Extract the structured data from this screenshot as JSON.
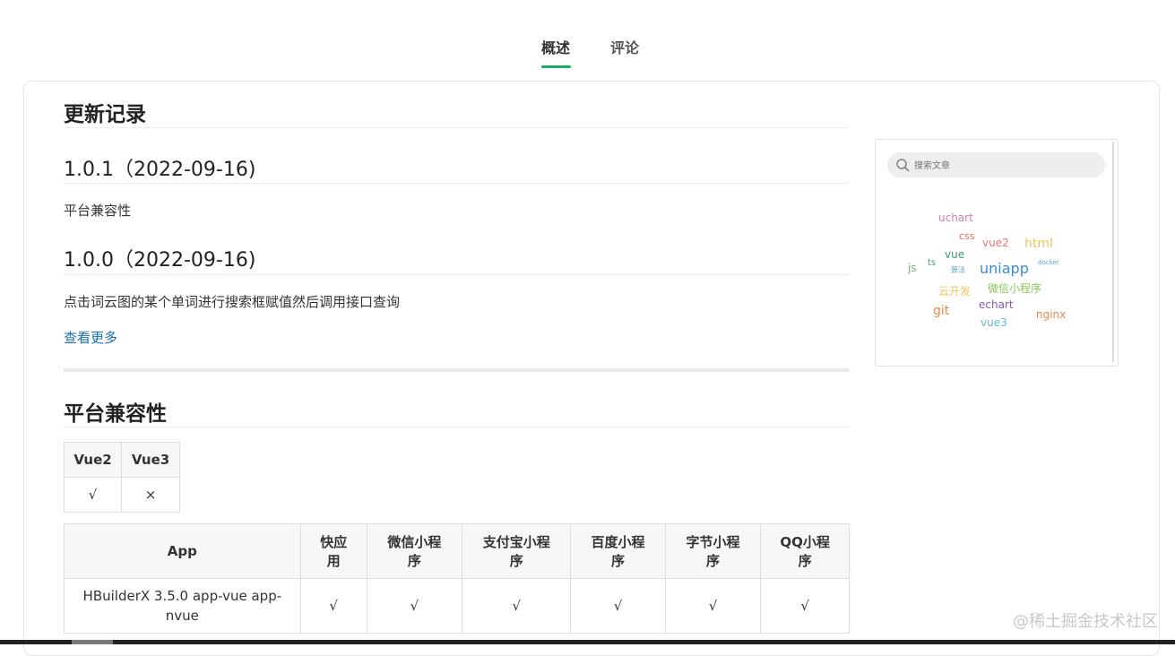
{
  "tabs": [
    "概述",
    "评论"
  ],
  "changelog": {
    "title": "更新记录",
    "versions": [
      {
        "heading": "1.0.1（2022-09-16)",
        "note": "平台兼容性"
      },
      {
        "heading": "1.0.0（2022-09-16)",
        "note": "点击词云图的某个单词进行搜索框赋值然后调用接口查询"
      }
    ],
    "more_label": "查看更多"
  },
  "compat": {
    "title": "平台兼容性",
    "vue_headers": [
      "Vue2",
      "Vue3"
    ],
    "vue_values": [
      "√",
      "×"
    ],
    "platform_headers": [
      "App",
      "快应\n用",
      "微信小程\n序",
      "支付宝小程\n序",
      "百度小程\n序",
      "字节小程\n序",
      "QQ小程\n序"
    ],
    "platform_row": [
      "HBuilderX 3.5.0 app-vue app-\nnvue",
      "√",
      "√",
      "√",
      "√",
      "√",
      "√"
    ]
  },
  "sidebar": {
    "search_placeholder": "搜索文章",
    "icon": "search-icon",
    "word_cloud": [
      {
        "text": "uchart",
        "color": "#d17fb8"
      },
      {
        "text": "css",
        "color": "#e86a6a"
      },
      {
        "text": "vue2",
        "color": "#e8747a"
      },
      {
        "text": "html",
        "color": "#f2c35a"
      },
      {
        "text": "js",
        "color": "#6aba6a"
      },
      {
        "text": "ts",
        "color": "#4a9a7a"
      },
      {
        "text": "vue",
        "color": "#3a9a6a"
      },
      {
        "text": "算法",
        "color": "#5aa5c5"
      },
      {
        "text": "uniapp",
        "color": "#3a8ad5"
      },
      {
        "text": "docker",
        "color": "#5aa5d5"
      },
      {
        "text": "云开发",
        "color": "#f2c35a"
      },
      {
        "text": "微信小程序",
        "color": "#8ac85a"
      },
      {
        "text": "git",
        "color": "#e8874a"
      },
      {
        "text": "echart",
        "color": "#8a5ab8"
      },
      {
        "text": "nginx",
        "color": "#e8874a"
      },
      {
        "text": "vue3",
        "color": "#6ab5d5"
      }
    ]
  },
  "watermark": "@稀土掘金技术社区",
  "accent_color": "#1aad6a"
}
